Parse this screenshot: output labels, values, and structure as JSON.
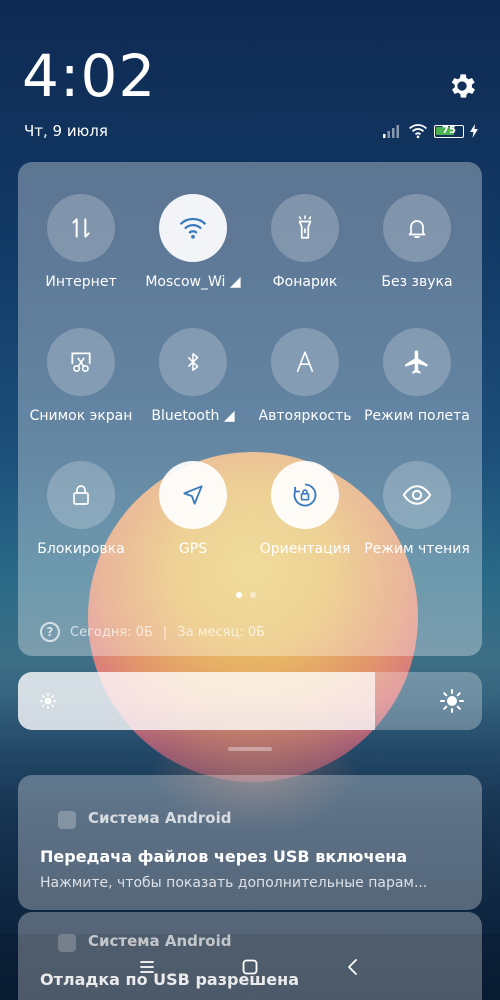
{
  "status_bar": {
    "time": "4:02",
    "date": "Чт, 9 июля",
    "battery_level": "75",
    "battery_fraction": 0.75,
    "icons": [
      "signal-icon",
      "wifi-icon",
      "battery-icon",
      "charging-icon"
    ]
  },
  "header": {
    "settings_icon": "gear-icon"
  },
  "quick_settings": {
    "tiles": [
      {
        "label": "Интернет",
        "icon": "data-arrows-icon",
        "active": false
      },
      {
        "label": "Moscow_Wi",
        "icon": "wifi-icon",
        "active": true
      },
      {
        "label": "Фонарик",
        "icon": "flashlight-icon",
        "active": false
      },
      {
        "label": "Без звука",
        "icon": "bell-icon",
        "active": false
      },
      {
        "label": "Снимок экран",
        "icon": "screenshot-icon",
        "active": false
      },
      {
        "label": "Bluetooth",
        "icon": "bluetooth-icon",
        "active": false
      },
      {
        "label": "Автояркость",
        "icon": "auto-brightness-icon",
        "active": false
      },
      {
        "label": "Режим полета",
        "icon": "airplane-icon",
        "active": false
      },
      {
        "label": "Блокировка",
        "icon": "lock-icon",
        "active": false
      },
      {
        "label": "GPS",
        "icon": "location-arrow-icon",
        "active": true
      },
      {
        "label": "Ориентация",
        "icon": "rotation-lock-icon",
        "active": true
      },
      {
        "label": "Режим чтения",
        "icon": "eye-icon",
        "active": false
      }
    ],
    "page_count": 2,
    "current_page": 1,
    "usage_today": "Сегодня: 0Б",
    "usage_separator": "|",
    "usage_month": "За месяц: 0Б"
  },
  "brightness": {
    "level": 0.77
  },
  "notifications": [
    {
      "app": "Система Android",
      "title": "Передача файлов через USB включена",
      "text": "Нажмите, чтобы показать дополнительные парам..."
    },
    {
      "app": "Система Android",
      "title": "Отладка по USB разрешена",
      "text": ""
    }
  ],
  "nav_bar": {
    "buttons": [
      "menu-icon",
      "home-icon",
      "back-icon"
    ]
  },
  "colors": {
    "battery_fill": "#4caf50",
    "tile_active": "#ffffff"
  }
}
